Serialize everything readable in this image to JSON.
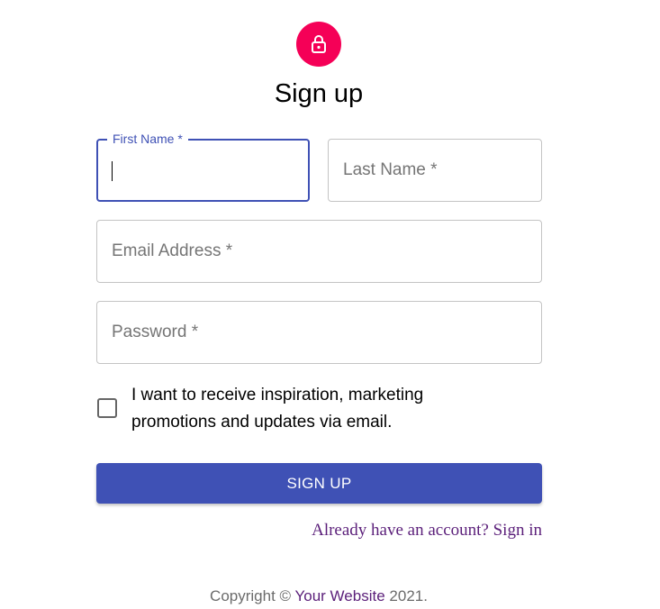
{
  "header": {
    "icon": "lock-icon",
    "title": "Sign up"
  },
  "form": {
    "first_name": {
      "label": "First Name *",
      "value": ""
    },
    "last_name": {
      "placeholder": "Last Name *"
    },
    "email": {
      "placeholder": "Email Address *"
    },
    "password": {
      "placeholder": "Password *"
    },
    "marketing_checkbox": {
      "checked": false,
      "label": "I want to receive inspiration, marketing promotions and updates via email."
    },
    "submit_label": "SIGN UP",
    "signin_link": "Already have an account? Sign in"
  },
  "footer": {
    "copyright_prefix": "Copyright ©",
    "website_link": "Your Website",
    "year_suffix": "2021."
  },
  "colors": {
    "avatar": "#f50057",
    "primary": "#3f51b5",
    "link": "#5b1f7a"
  }
}
